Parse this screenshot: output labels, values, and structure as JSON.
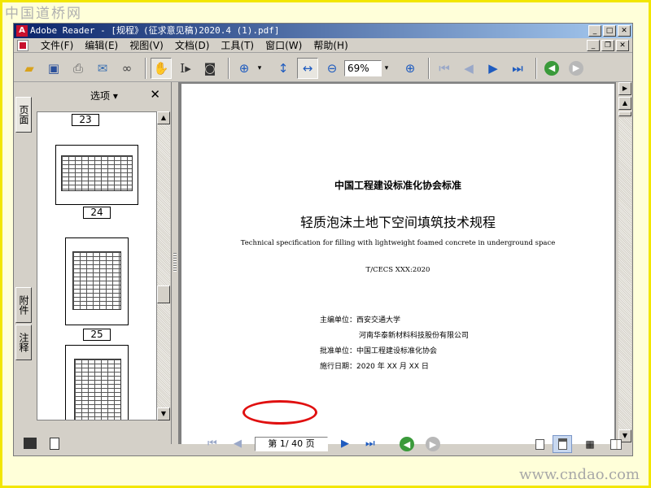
{
  "watermark": {
    "site_logo": "中国道桥网",
    "site_url": "www.cndao.com"
  },
  "titlebar": {
    "text": "Adobe Reader - [规程》(征求意见稿)2020.4 (1).pdf]",
    "app_icon_letter": "A",
    "minimize": "_",
    "maximize": "□",
    "close": "✕"
  },
  "menubar": {
    "items": [
      "文件(F)",
      "编辑(E)",
      "视图(V)",
      "文档(D)",
      "工具(T)",
      "窗口(W)",
      "帮助(H)"
    ]
  },
  "toolbar": {
    "zoom_value": "69%"
  },
  "side_tabs": {
    "pages": "页面",
    "attachments": "附件",
    "comments": "注释"
  },
  "sidebar": {
    "options_label": "选项 ▾",
    "close_label": "✕",
    "thumbnail_labels": [
      "23",
      "24",
      "25"
    ]
  },
  "document": {
    "org": "中国工程建设标准化协会标准",
    "title_cn": "轻质泡沫土地下空间填筑技术规程",
    "title_en": "Technical specification for filling with lightweight foamed concrete in underground space",
    "code": "T/CECS XXX:2020",
    "chief_editor_label": "主编单位：西安交通大学",
    "co_editor": "河南华泰新材料科技股份有限公司",
    "approver_label": "批准单位：中国工程建设标准化协会",
    "effective_label": "施行日期：2020 年 XX 月 XX 日"
  },
  "statusbar": {
    "page_indicator": "第 1/ 40 页"
  },
  "colors": {
    "title_gradient_start": "#0a246a",
    "title_gradient_end": "#a6caf0",
    "window_face": "#d4d0c8",
    "highlight_ring": "#e01010",
    "frame_border": "#f2e600"
  }
}
